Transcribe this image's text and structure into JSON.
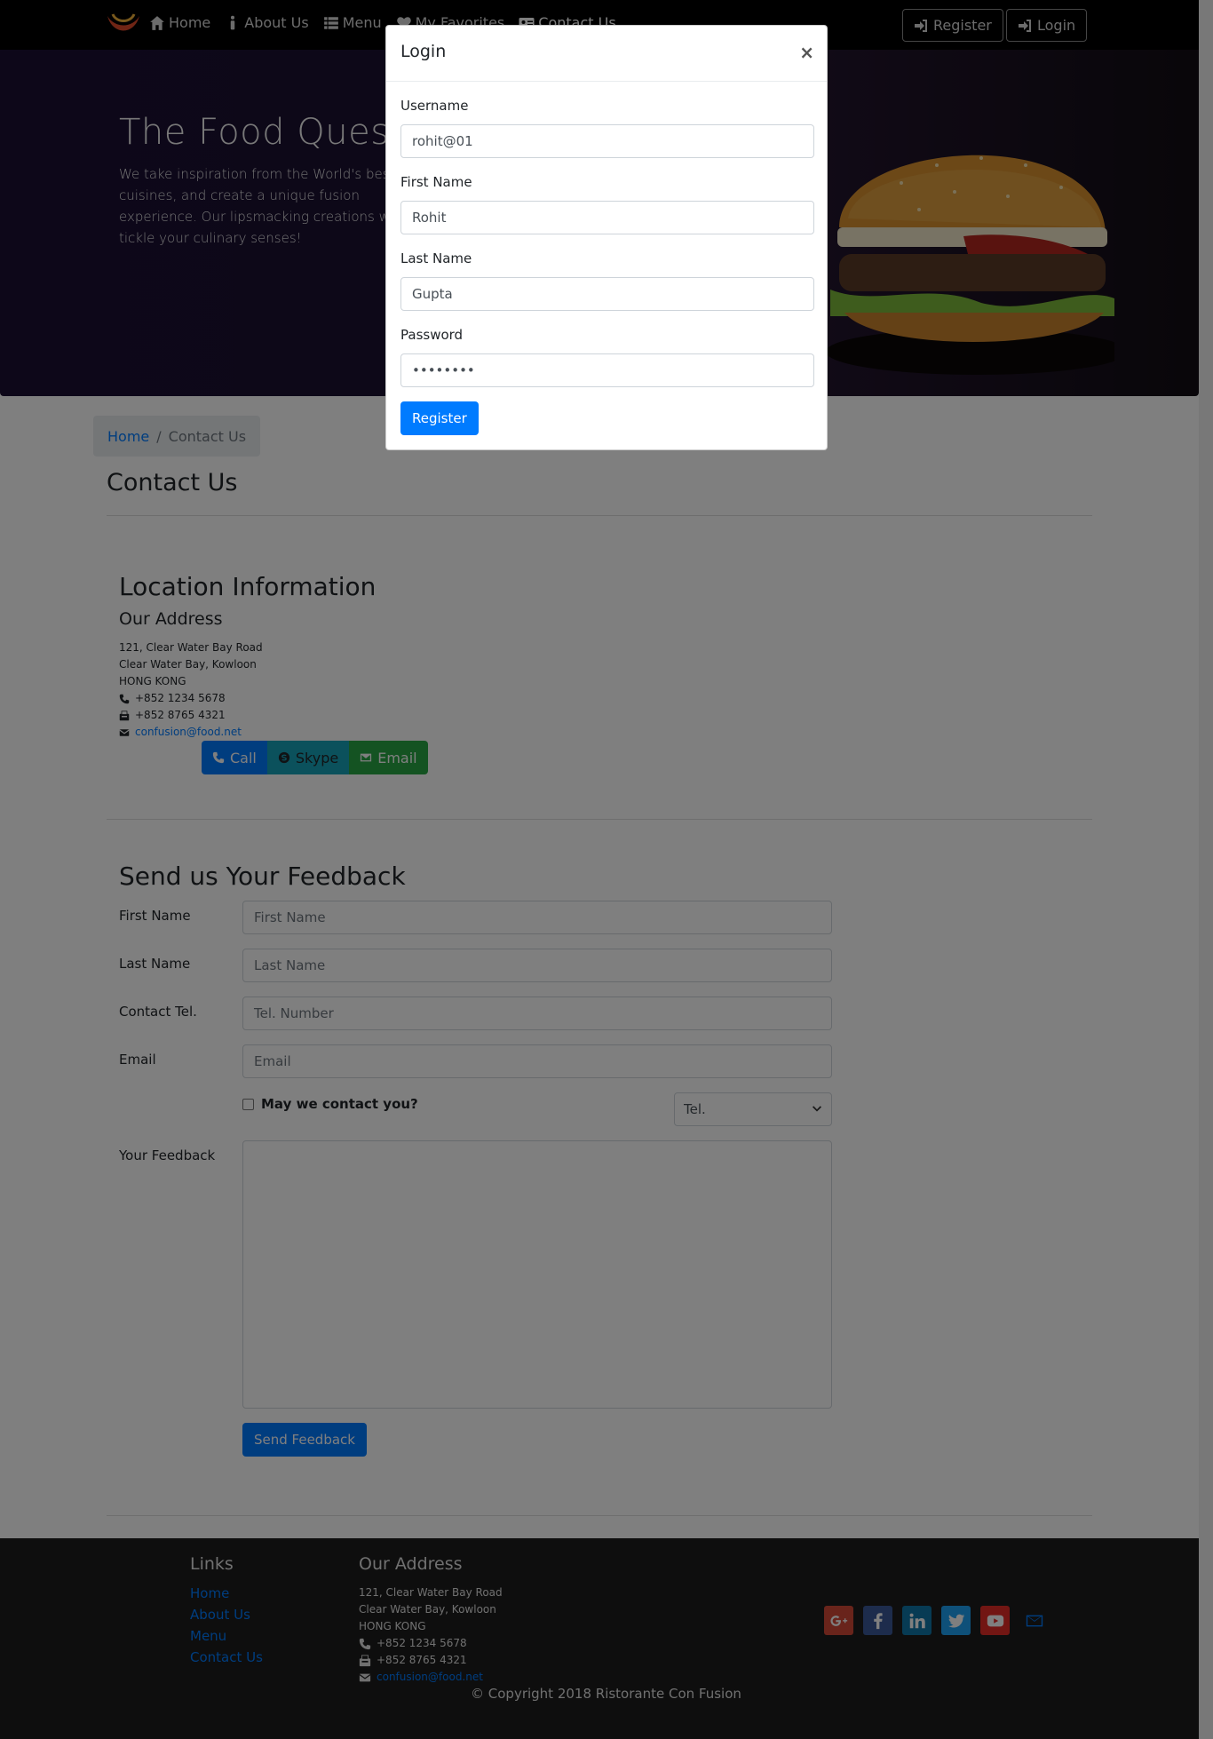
{
  "nav": {
    "items": [
      {
        "label": "Home",
        "icon": "home-icon"
      },
      {
        "label": "About Us",
        "icon": "info-icon"
      },
      {
        "label": "Menu",
        "icon": "list-icon"
      },
      {
        "label": "My Favorites",
        "icon": "heart-icon"
      },
      {
        "label": "Contact Us",
        "icon": "address-card-icon"
      }
    ],
    "register_label": "Register",
    "login_label": "Login"
  },
  "jumbotron": {
    "title": "The Food Quest",
    "text": "We take inspiration from the World's best cuisines, and create a unique fusion experience. Our lipsmacking creations will tickle your culinary senses!"
  },
  "breadcrumb": {
    "home": "Home",
    "current": "Contact Us"
  },
  "page_title": "Contact Us",
  "location": {
    "heading": "Location Information",
    "subheading": "Our Address",
    "line1": "121, Clear Water Bay Road",
    "line2": "Clear Water Bay, Kowloon",
    "line3": "HONG KONG",
    "phone": "+852 1234 5678",
    "fax": "+852 8765 4321",
    "email": "confusion@food.net",
    "buttons": {
      "call": "Call",
      "skype": "Skype",
      "email": "Email"
    }
  },
  "feedback": {
    "heading": "Send us Your Feedback",
    "first_name_label": "First Name",
    "first_name_placeholder": "First Name",
    "last_name_label": "Last Name",
    "last_name_placeholder": "Last Name",
    "tel_label": "Contact Tel.",
    "tel_placeholder": "Tel. Number",
    "email_label": "Email",
    "email_placeholder": "Email",
    "contact_check": "May we contact you?",
    "contact_select": "Tel.",
    "feedback_label": "Your Feedback",
    "submit": "Send Feedback"
  },
  "footer": {
    "links_heading": "Links",
    "links": [
      "Home",
      "About Us",
      "Menu",
      "Contact Us"
    ],
    "address_heading": "Our Address",
    "line1": "121, Clear Water Bay Road",
    "line2": "Clear Water Bay, Kowloon",
    "line3": "HONG KONG",
    "phone": "+852 1234 5678",
    "fax": "+852 8765 4321",
    "email": "confusion@food.net",
    "copyright": "© Copyright 2018 Ristorante Con Fusion",
    "socials": [
      {
        "icon": "google-plus-icon",
        "color": "#d34836"
      },
      {
        "icon": "facebook-icon",
        "color": "#3b5998"
      },
      {
        "icon": "linkedin-icon",
        "color": "#0e76a8"
      },
      {
        "icon": "twitter-icon",
        "color": "#1da1f2"
      },
      {
        "icon": "youtube-icon",
        "color": "#e52d27"
      },
      {
        "icon": "envelope-icon",
        "color": "#007bff"
      }
    ]
  },
  "modal": {
    "title": "Login",
    "close": "×",
    "username_label": "Username",
    "username_value": "rohit@01",
    "first_name_label": "First Name",
    "first_name_value": "Rohit",
    "last_name_label": "Last Name",
    "last_name_value": "Gupta",
    "password_label": "Password",
    "password_value": "••••••••",
    "submit": "Register"
  }
}
